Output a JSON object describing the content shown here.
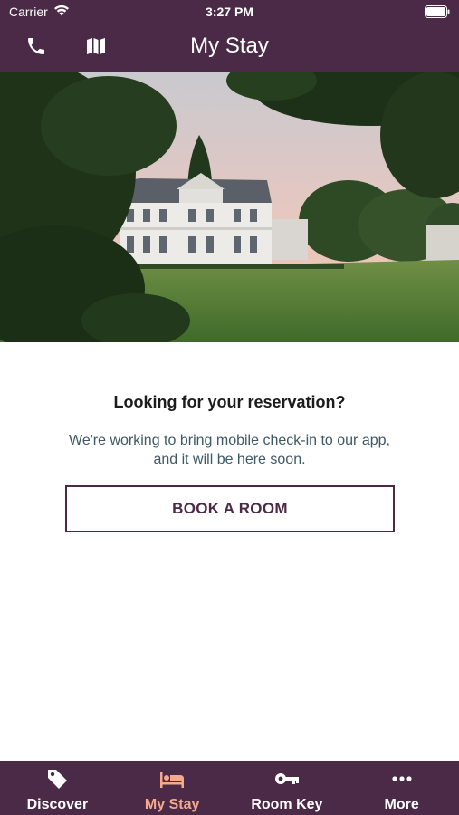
{
  "status_bar": {
    "carrier": "Carrier",
    "time": "3:27 PM"
  },
  "nav": {
    "title": "My Stay",
    "phone_icon": "phone-icon",
    "map_icon": "map-icon"
  },
  "content": {
    "heading": "Looking for your reservation?",
    "subtext": "We're working to bring mobile check-in to our app, and it will be here soon.",
    "book_button": "BOOK A ROOM"
  },
  "tabs": [
    {
      "label": "Discover",
      "icon": "tag-icon",
      "active": false
    },
    {
      "label": "My Stay",
      "icon": "bed-icon",
      "active": true
    },
    {
      "label": "Room Key",
      "icon": "key-icon",
      "active": false
    },
    {
      "label": "More",
      "icon": "more-icon",
      "active": false
    }
  ],
  "colors": {
    "brand": "#4b2a47",
    "active_tab": "#f4a98c",
    "subtext": "#3e5866"
  }
}
